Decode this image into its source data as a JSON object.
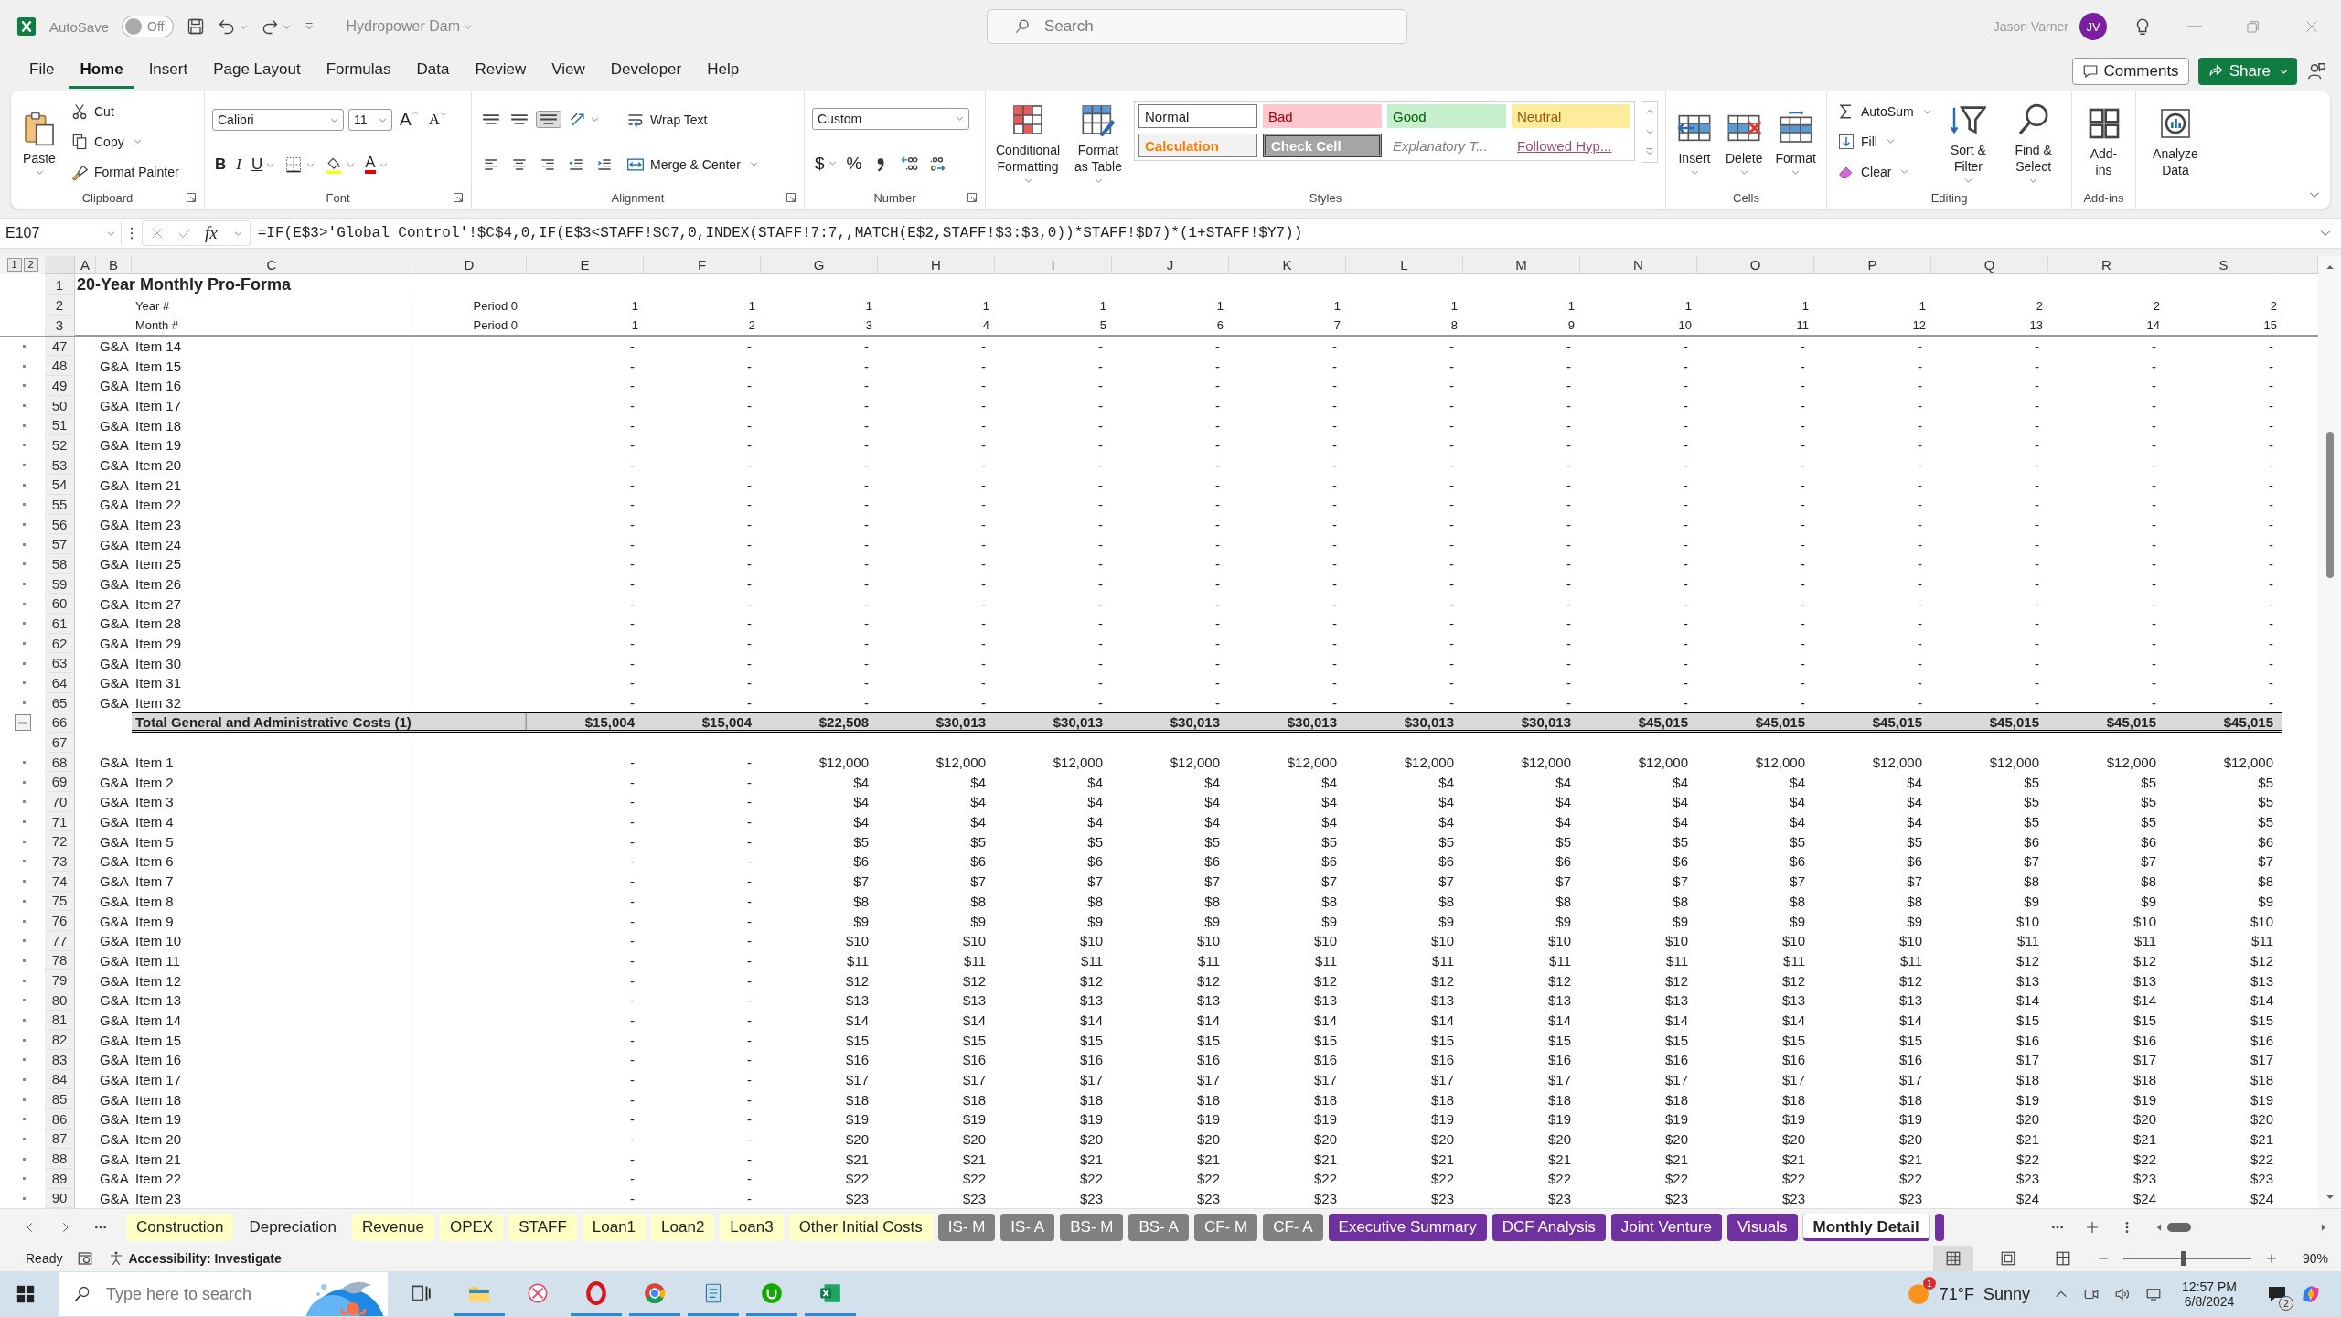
{
  "title_bar": {
    "autosave_label": "AutoSave",
    "autosave_toggle": {
      "label": "Off",
      "on": false
    },
    "document_title": "Hydropower Dam",
    "search": {
      "placeholder": "Search"
    },
    "user_name": "Jason Varner",
    "avatar": "JV"
  },
  "menu_tabs": [
    {
      "label": "File",
      "selected": false
    },
    {
      "label": "Home",
      "selected": true
    },
    {
      "label": "Insert",
      "selected": false
    },
    {
      "label": "Page Layout",
      "selected": false
    },
    {
      "label": "Formulas",
      "selected": false
    },
    {
      "label": "Data",
      "selected": false
    },
    {
      "label": "Review",
      "selected": false
    },
    {
      "label": "View",
      "selected": false
    },
    {
      "label": "Developer",
      "selected": false
    },
    {
      "label": "Help",
      "selected": false
    }
  ],
  "header_buttons": {
    "comments": "Comments",
    "share": "Share"
  },
  "ribbon": [
    {
      "label": "Clipboard",
      "launcher": true,
      "columns": [
        [
          [
            {
              "kind": "large",
              "label": "Paste",
              "caret": true
            }
          ]
        ],
        [
          [
            {
              "kind": "small",
              "label": "Cut"
            }
          ],
          [
            {
              "kind": "small",
              "label": "Copy",
              "caret": true
            }
          ],
          [
            {
              "kind": "small",
              "label": "Format Painter"
            }
          ]
        ]
      ]
    },
    {
      "label": "Font",
      "launcher": true,
      "columns": [
        [
          [
            {
              "kind": "combo",
              "value": "Calibri"
            },
            {
              "kind": "combo",
              "value": "11"
            },
            {
              "kind": "grow",
              "label": "A"
            },
            {
              "kind": "shrink",
              "label": "A"
            }
          ],
          [
            {
              "kind": "bold",
              "label": "B"
            },
            {
              "kind": "italic",
              "label": "I"
            },
            {
              "kind": "underline",
              "label": "U",
              "caret": true
            },
            {
              "kind": "icon",
              "caret": true
            },
            {
              "kind": "icon",
              "caret": true
            },
            {
              "kind": "fontcolor",
              "label": "A",
              "caret": true
            }
          ]
        ]
      ]
    },
    {
      "label": "Alignment",
      "launcher": true,
      "columns": [
        [
          [
            {
              "kind": "icon",
              "on": false
            },
            {
              "kind": "icon",
              "on": false
            },
            {
              "kind": "icon",
              "on": true
            },
            {
              "kind": "icon",
              "caret": true
            }
          ],
          [
            {
              "kind": "icon"
            },
            {
              "kind": "icon"
            },
            {
              "kind": "icon"
            },
            {
              "kind": "icon"
            },
            {
              "kind": "icon"
            }
          ]
        ],
        [
          [
            {
              "kind": "small",
              "label": "Wrap Text"
            }
          ],
          [
            {
              "kind": "small",
              "label": "Merge & Center",
              "caret": true
            }
          ]
        ]
      ]
    },
    {
      "label": "Number",
      "launcher": true,
      "columns": [
        [
          [
            {
              "kind": "combo",
              "value": "Custom"
            }
          ],
          [
            {
              "kind": "letter",
              "label": "$",
              "caret": true
            },
            {
              "kind": "letter",
              "label": "%"
            },
            {
              "kind": "icon"
            },
            {
              "kind": "icon"
            },
            {
              "kind": "icon"
            }
          ]
        ]
      ]
    },
    {
      "label": "Styles",
      "columns": [
        [
          [
            {
              "kind": "large",
              "label": "Conditional Formatting",
              "caret": true
            }
          ]
        ],
        [
          [
            {
              "kind": "large",
              "label": "Format as Table",
              "caret": true
            }
          ]
        ],
        [
          [
            {
              "kind": "normal",
              "label": "Normal"
            },
            {
              "kind": "bad",
              "label": "Bad"
            },
            {
              "kind": "good",
              "label": "Good"
            },
            {
              "kind": "neutral",
              "label": "Neutral"
            }
          ],
          [
            {
              "kind": "calculation",
              "label": "Calculation"
            },
            {
              "kind": "check",
              "label": "Check Cell"
            },
            {
              "kind": "explanatory",
              "label": "Explanatory T..."
            },
            {
              "kind": "followed",
              "label": "Followed Hyp..."
            }
          ]
        ]
      ]
    },
    {
      "label": "Cells",
      "columns": [
        [
          [
            {
              "kind": "large",
              "label": "Insert",
              "caret": true
            }
          ]
        ],
        [
          [
            {
              "kind": "large",
              "label": "Delete",
              "caret": true
            }
          ]
        ],
        [
          [
            {
              "kind": "large",
              "label": "Format",
              "caret": true
            }
          ]
        ]
      ]
    },
    {
      "label": "Editing",
      "columns": [
        [
          [
            {
              "kind": "small",
              "label": "AutoSum",
              "caret": true
            }
          ],
          [
            {
              "kind": "small",
              "label": "Fill",
              "caret": true
            }
          ],
          [
            {
              "kind": "small",
              "label": "Clear",
              "caret": true
            }
          ]
        ],
        [
          [
            {
              "kind": "large",
              "label": "Sort & Filter",
              "caret": true
            }
          ]
        ],
        [
          [
            {
              "kind": "large",
              "label": "Find & Select",
              "caret": true
            }
          ]
        ]
      ]
    },
    {
      "label": "Add-ins",
      "columns": [
        [
          [
            {
              "kind": "large",
              "label": "Add-ins"
            }
          ]
        ]
      ]
    },
    {
      "columns": [
        [
          [
            {
              "kind": "large",
              "label": "Analyze Data"
            }
          ]
        ]
      ]
    }
  ],
  "formula_bar": {
    "name_box": "E107",
    "function_label": "fx",
    "formula": "=IF(E$3>'Global Control'!$C$4,0,IF(E$3<STAFF!$C7,0,INDEX(STAFF!7:7,,MATCH(E$2,STAFF!$3:$3,0))*STAFF!$D7)*(1+STAFF!$Y7))"
  },
  "sheet": {
    "outline_levels": [
      "1",
      "2"
    ],
    "columns": [
      "A",
      "B",
      "C",
      "D",
      "E",
      "F",
      "G",
      "H",
      "I",
      "J",
      "K",
      "L",
      "M",
      "N",
      "O",
      "P",
      "Q",
      "R",
      "S"
    ],
    "rows": [
      {
        "row": "1",
        "kind": "title",
        "text": "20-Year Monthly Pro-Forma"
      },
      {
        "row": "2",
        "kind": "header",
        "label": "Year #",
        "period": "Period 0",
        "values": [
          "1",
          "1",
          "1",
          "1",
          "1",
          "1",
          "1",
          "1",
          "1",
          "1",
          "1",
          "1",
          "2",
          "2",
          "2"
        ]
      },
      {
        "row": "3",
        "kind": "header",
        "label": "Month #",
        "period": "Period 0",
        "values": [
          "1",
          "2",
          "3",
          "4",
          "5",
          "6",
          "7",
          "8",
          "9",
          "10",
          "11",
          "12",
          "13",
          "14",
          "15"
        ]
      },
      {
        "row": "47",
        "kind": "item",
        "group": "G&A",
        "item": "Item 14",
        "values": [
          "-",
          "-",
          "-",
          "-",
          "-",
          "-",
          "-",
          "-",
          "-",
          "-",
          "-",
          "-",
          "-",
          "-",
          "-"
        ]
      },
      {
        "row": "48",
        "kind": "item",
        "group": "G&A",
        "item": "Item 15",
        "values": [
          "-",
          "-",
          "-",
          "-",
          "-",
          "-",
          "-",
          "-",
          "-",
          "-",
          "-",
          "-",
          "-",
          "-",
          "-"
        ]
      },
      {
        "row": "49",
        "kind": "item",
        "group": "G&A",
        "item": "Item 16",
        "values": [
          "-",
          "-",
          "-",
          "-",
          "-",
          "-",
          "-",
          "-",
          "-",
          "-",
          "-",
          "-",
          "-",
          "-",
          "-"
        ]
      },
      {
        "row": "50",
        "kind": "item",
        "group": "G&A",
        "item": "Item 17",
        "values": [
          "-",
          "-",
          "-",
          "-",
          "-",
          "-",
          "-",
          "-",
          "-",
          "-",
          "-",
          "-",
          "-",
          "-",
          "-"
        ]
      },
      {
        "row": "51",
        "kind": "item",
        "group": "G&A",
        "item": "Item 18",
        "values": [
          "-",
          "-",
          "-",
          "-",
          "-",
          "-",
          "-",
          "-",
          "-",
          "-",
          "-",
          "-",
          "-",
          "-",
          "-"
        ]
      },
      {
        "row": "52",
        "kind": "item",
        "group": "G&A",
        "item": "Item 19",
        "values": [
          "-",
          "-",
          "-",
          "-",
          "-",
          "-",
          "-",
          "-",
          "-",
          "-",
          "-",
          "-",
          "-",
          "-",
          "-"
        ]
      },
      {
        "row": "53",
        "kind": "item",
        "group": "G&A",
        "item": "Item 20",
        "values": [
          "-",
          "-",
          "-",
          "-",
          "-",
          "-",
          "-",
          "-",
          "-",
          "-",
          "-",
          "-",
          "-",
          "-",
          "-"
        ]
      },
      {
        "row": "54",
        "kind": "item",
        "group": "G&A",
        "item": "Item 21",
        "values": [
          "-",
          "-",
          "-",
          "-",
          "-",
          "-",
          "-",
          "-",
          "-",
          "-",
          "-",
          "-",
          "-",
          "-",
          "-"
        ]
      },
      {
        "row": "55",
        "kind": "item",
        "group": "G&A",
        "item": "Item 22",
        "values": [
          "-",
          "-",
          "-",
          "-",
          "-",
          "-",
          "-",
          "-",
          "-",
          "-",
          "-",
          "-",
          "-",
          "-",
          "-"
        ]
      },
      {
        "row": "56",
        "kind": "item",
        "group": "G&A",
        "item": "Item 23",
        "values": [
          "-",
          "-",
          "-",
          "-",
          "-",
          "-",
          "-",
          "-",
          "-",
          "-",
          "-",
          "-",
          "-",
          "-",
          "-"
        ]
      },
      {
        "row": "57",
        "kind": "item",
        "group": "G&A",
        "item": "Item 24",
        "values": [
          "-",
          "-",
          "-",
          "-",
          "-",
          "-",
          "-",
          "-",
          "-",
          "-",
          "-",
          "-",
          "-",
          "-",
          "-"
        ]
      },
      {
        "row": "58",
        "kind": "item",
        "group": "G&A",
        "item": "Item 25",
        "values": [
          "-",
          "-",
          "-",
          "-",
          "-",
          "-",
          "-",
          "-",
          "-",
          "-",
          "-",
          "-",
          "-",
          "-",
          "-"
        ]
      },
      {
        "row": "59",
        "kind": "item",
        "group": "G&A",
        "item": "Item 26",
        "values": [
          "-",
          "-",
          "-",
          "-",
          "-",
          "-",
          "-",
          "-",
          "-",
          "-",
          "-",
          "-",
          "-",
          "-",
          "-"
        ]
      },
      {
        "row": "60",
        "kind": "item",
        "group": "G&A",
        "item": "Item 27",
        "values": [
          "-",
          "-",
          "-",
          "-",
          "-",
          "-",
          "-",
          "-",
          "-",
          "-",
          "-",
          "-",
          "-",
          "-",
          "-"
        ]
      },
      {
        "row": "61",
        "kind": "item",
        "group": "G&A",
        "item": "Item 28",
        "values": [
          "-",
          "-",
          "-",
          "-",
          "-",
          "-",
          "-",
          "-",
          "-",
          "-",
          "-",
          "-",
          "-",
          "-",
          "-"
        ]
      },
      {
        "row": "62",
        "kind": "item",
        "group": "G&A",
        "item": "Item 29",
        "values": [
          "-",
          "-",
          "-",
          "-",
          "-",
          "-",
          "-",
          "-",
          "-",
          "-",
          "-",
          "-",
          "-",
          "-",
          "-"
        ]
      },
      {
        "row": "63",
        "kind": "item",
        "group": "G&A",
        "item": "Item 30",
        "values": [
          "-",
          "-",
          "-",
          "-",
          "-",
          "-",
          "-",
          "-",
          "-",
          "-",
          "-",
          "-",
          "-",
          "-",
          "-"
        ]
      },
      {
        "row": "64",
        "kind": "item",
        "group": "G&A",
        "item": "Item 31",
        "values": [
          "-",
          "-",
          "-",
          "-",
          "-",
          "-",
          "-",
          "-",
          "-",
          "-",
          "-",
          "-",
          "-",
          "-",
          "-"
        ]
      },
      {
        "row": "65",
        "kind": "item",
        "group": "G&A",
        "item": "Item 32",
        "values": [
          "-",
          "-",
          "-",
          "-",
          "-",
          "-",
          "-",
          "-",
          "-",
          "-",
          "-",
          "-",
          "-",
          "-",
          "-"
        ]
      },
      {
        "row": "66",
        "kind": "total",
        "label": "Total General and Administrative Costs (1)",
        "values": [
          "$15,004",
          "$15,004",
          "$22,508",
          "$30,013",
          "$30,013",
          "$30,013",
          "$30,013",
          "$30,013",
          "$30,013",
          "$45,015",
          "$45,015",
          "$45,015",
          "$45,015",
          "$45,015",
          "$45,015"
        ]
      },
      {
        "row": "67",
        "kind": "blank"
      },
      {
        "row": "68",
        "kind": "item",
        "group": "G&A",
        "item": "Item 1",
        "values": [
          "-",
          "-",
          "$12,000",
          "$12,000",
          "$12,000",
          "$12,000",
          "$12,000",
          "$12,000",
          "$12,000",
          "$12,000",
          "$12,000",
          "$12,000",
          "$12,000",
          "$12,000",
          "$12,000"
        ]
      },
      {
        "row": "69",
        "kind": "item",
        "group": "G&A",
        "item": "Item 2",
        "values": [
          "-",
          "-",
          "$4",
          "$4",
          "$4",
          "$4",
          "$4",
          "$4",
          "$4",
          "$4",
          "$4",
          "$4",
          "$5",
          "$5",
          "$5"
        ]
      },
      {
        "row": "70",
        "kind": "item",
        "group": "G&A",
        "item": "Item 3",
        "values": [
          "-",
          "-",
          "$4",
          "$4",
          "$4",
          "$4",
          "$4",
          "$4",
          "$4",
          "$4",
          "$4",
          "$4",
          "$5",
          "$5",
          "$5"
        ]
      },
      {
        "row": "71",
        "kind": "item",
        "group": "G&A",
        "item": "Item 4",
        "values": [
          "-",
          "-",
          "$4",
          "$4",
          "$4",
          "$4",
          "$4",
          "$4",
          "$4",
          "$4",
          "$4",
          "$4",
          "$5",
          "$5",
          "$5"
        ]
      },
      {
        "row": "72",
        "kind": "item",
        "group": "G&A",
        "item": "Item 5",
        "values": [
          "-",
          "-",
          "$5",
          "$5",
          "$5",
          "$5",
          "$5",
          "$5",
          "$5",
          "$5",
          "$5",
          "$5",
          "$6",
          "$6",
          "$6"
        ]
      },
      {
        "row": "73",
        "kind": "item",
        "group": "G&A",
        "item": "Item 6",
        "values": [
          "-",
          "-",
          "$6",
          "$6",
          "$6",
          "$6",
          "$6",
          "$6",
          "$6",
          "$6",
          "$6",
          "$6",
          "$7",
          "$7",
          "$7"
        ]
      },
      {
        "row": "74",
        "kind": "item",
        "group": "G&A",
        "item": "Item 7",
        "values": [
          "-",
          "-",
          "$7",
          "$7",
          "$7",
          "$7",
          "$7",
          "$7",
          "$7",
          "$7",
          "$7",
          "$7",
          "$8",
          "$8",
          "$8"
        ]
      },
      {
        "row": "75",
        "kind": "item",
        "group": "G&A",
        "item": "Item 8",
        "values": [
          "-",
          "-",
          "$8",
          "$8",
          "$8",
          "$8",
          "$8",
          "$8",
          "$8",
          "$8",
          "$8",
          "$8",
          "$9",
          "$9",
          "$9"
        ]
      },
      {
        "row": "76",
        "kind": "item",
        "group": "G&A",
        "item": "Item 9",
        "values": [
          "-",
          "-",
          "$9",
          "$9",
          "$9",
          "$9",
          "$9",
          "$9",
          "$9",
          "$9",
          "$9",
          "$9",
          "$10",
          "$10",
          "$10"
        ]
      },
      {
        "row": "77",
        "kind": "item",
        "group": "G&A",
        "item": "Item 10",
        "values": [
          "-",
          "-",
          "$10",
          "$10",
          "$10",
          "$10",
          "$10",
          "$10",
          "$10",
          "$10",
          "$10",
          "$10",
          "$11",
          "$11",
          "$11"
        ]
      },
      {
        "row": "78",
        "kind": "item",
        "group": "G&A",
        "item": "Item 11",
        "values": [
          "-",
          "-",
          "$11",
          "$11",
          "$11",
          "$11",
          "$11",
          "$11",
          "$11",
          "$11",
          "$11",
          "$11",
          "$12",
          "$12",
          "$12"
        ]
      },
      {
        "row": "79",
        "kind": "item",
        "group": "G&A",
        "item": "Item 12",
        "values": [
          "-",
          "-",
          "$12",
          "$12",
          "$12",
          "$12",
          "$12",
          "$12",
          "$12",
          "$12",
          "$12",
          "$12",
          "$13",
          "$13",
          "$13"
        ]
      },
      {
        "row": "80",
        "kind": "item",
        "group": "G&A",
        "item": "Item 13",
        "values": [
          "-",
          "-",
          "$13",
          "$13",
          "$13",
          "$13",
          "$13",
          "$13",
          "$13",
          "$13",
          "$13",
          "$13",
          "$14",
          "$14",
          "$14"
        ]
      },
      {
        "row": "81",
        "kind": "item",
        "group": "G&A",
        "item": "Item 14",
        "values": [
          "-",
          "-",
          "$14",
          "$14",
          "$14",
          "$14",
          "$14",
          "$14",
          "$14",
          "$14",
          "$14",
          "$14",
          "$15",
          "$15",
          "$15"
        ]
      },
      {
        "row": "82",
        "kind": "item",
        "group": "G&A",
        "item": "Item 15",
        "values": [
          "-",
          "-",
          "$15",
          "$15",
          "$15",
          "$15",
          "$15",
          "$15",
          "$15",
          "$15",
          "$15",
          "$15",
          "$16",
          "$16",
          "$16"
        ]
      },
      {
        "row": "83",
        "kind": "item",
        "group": "G&A",
        "item": "Item 16",
        "values": [
          "-",
          "-",
          "$16",
          "$16",
          "$16",
          "$16",
          "$16",
          "$16",
          "$16",
          "$16",
          "$16",
          "$16",
          "$17",
          "$17",
          "$17"
        ]
      },
      {
        "row": "84",
        "kind": "item",
        "group": "G&A",
        "item": "Item 17",
        "values": [
          "-",
          "-",
          "$17",
          "$17",
          "$17",
          "$17",
          "$17",
          "$17",
          "$17",
          "$17",
          "$17",
          "$17",
          "$18",
          "$18",
          "$18"
        ]
      },
      {
        "row": "85",
        "kind": "item",
        "group": "G&A",
        "item": "Item 18",
        "values": [
          "-",
          "-",
          "$18",
          "$18",
          "$18",
          "$18",
          "$18",
          "$18",
          "$18",
          "$18",
          "$18",
          "$18",
          "$19",
          "$19",
          "$19"
        ]
      },
      {
        "row": "86",
        "kind": "item",
        "group": "G&A",
        "item": "Item 19",
        "values": [
          "-",
          "-",
          "$19",
          "$19",
          "$19",
          "$19",
          "$19",
          "$19",
          "$19",
          "$19",
          "$19",
          "$19",
          "$20",
          "$20",
          "$20"
        ]
      },
      {
        "row": "87",
        "kind": "item",
        "group": "G&A",
        "item": "Item 20",
        "values": [
          "-",
          "-",
          "$20",
          "$20",
          "$20",
          "$20",
          "$20",
          "$20",
          "$20",
          "$20",
          "$20",
          "$20",
          "$21",
          "$21",
          "$21"
        ]
      },
      {
        "row": "88",
        "kind": "item",
        "group": "G&A",
        "item": "Item 21",
        "values": [
          "-",
          "-",
          "$21",
          "$21",
          "$21",
          "$21",
          "$21",
          "$21",
          "$21",
          "$21",
          "$21",
          "$21",
          "$22",
          "$22",
          "$22"
        ]
      },
      {
        "row": "89",
        "kind": "item",
        "group": "G&A",
        "item": "Item 22",
        "values": [
          "-",
          "-",
          "$22",
          "$22",
          "$22",
          "$22",
          "$22",
          "$22",
          "$22",
          "$22",
          "$22",
          "$22",
          "$23",
          "$23",
          "$23"
        ]
      },
      {
        "row": "90",
        "kind": "item",
        "group": "G&A",
        "item": "Item 23",
        "values": [
          "-",
          "-",
          "$23",
          "$23",
          "$23",
          "$23",
          "$23",
          "$23",
          "$23",
          "$23",
          "$23",
          "$23",
          "$24",
          "$24",
          "$24"
        ]
      }
    ]
  },
  "sheet_tabs": [
    {
      "label": "Construction",
      "color": "#ffffc5",
      "selected": false
    },
    {
      "label": "Depreciation",
      "selected": false
    },
    {
      "label": "Revenue",
      "color": "#ffffc5",
      "selected": false
    },
    {
      "label": "OPEX",
      "color": "#ffffc5",
      "selected": false
    },
    {
      "label": "STAFF",
      "color": "#ffffc5",
      "selected": false
    },
    {
      "label": "Loan1",
      "color": "#ffffc5",
      "selected": false
    },
    {
      "label": "Loan2",
      "color": "#ffffc5",
      "selected": false
    },
    {
      "label": "Loan3",
      "color": "#ffffc5",
      "selected": false
    },
    {
      "label": "Other Initial Costs",
      "color": "#ffffc5",
      "selected": false
    },
    {
      "label": "IS- M",
      "color": "#808080",
      "selected": false
    },
    {
      "label": "IS- A",
      "color": "#808080",
      "selected": false
    },
    {
      "label": "BS- M",
      "color": "#808080",
      "selected": false
    },
    {
      "label": "BS- A",
      "color": "#808080",
      "selected": false
    },
    {
      "label": "CF- M",
      "color": "#808080",
      "selected": false
    },
    {
      "label": "CF- A",
      "color": "#808080",
      "selected": false
    },
    {
      "label": "Executive Summary",
      "color": "#7030a0",
      "selected": false
    },
    {
      "label": "DCF Analysis",
      "color": "#7030a0",
      "selected": false
    },
    {
      "label": "Joint Venture",
      "color": "#7030a0",
      "selected": false
    },
    {
      "label": "Visuals",
      "color": "#7030a0",
      "selected": false
    },
    {
      "label": "Monthly Detail",
      "color": "#7030a0",
      "selected": true
    },
    {
      "color": "#7030a0",
      "selected": false
    }
  ],
  "status_bar": {
    "mode": "Ready",
    "accessibility": "Accessibility: Investigate",
    "views": [
      {
        "selected": true
      },
      {
        "selected": false
      },
      {
        "selected": false
      }
    ],
    "zoom": {
      "level": 0.47,
      "label": "90%"
    }
  },
  "taskbar": {
    "search_placeholder": "Type here to search",
    "apps": [
      {
        "running": false
      },
      {
        "running": true
      },
      {
        "running": false
      },
      {
        "running": true
      },
      {
        "running": true
      },
      {
        "running": true
      },
      {
        "running": true
      },
      {
        "running": true
      }
    ],
    "weather_badge": "1",
    "temperature": "71°F",
    "weather": "Sunny",
    "time": "12:57 PM",
    "date": "6/8/2024",
    "notification_count": "2"
  }
}
